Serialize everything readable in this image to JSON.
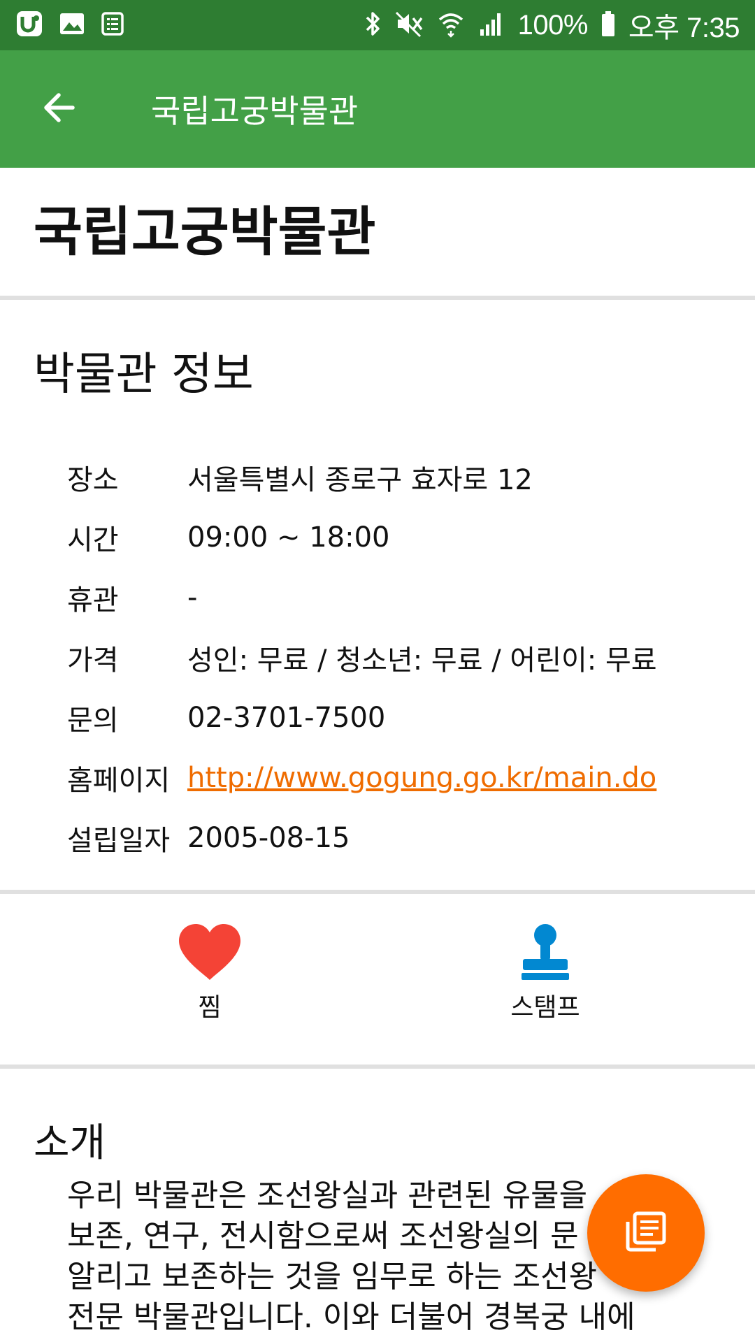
{
  "status_bar": {
    "battery": "100%",
    "time": "오후 7:35",
    "left_icons": [
      "u-plus-icon",
      "image-icon",
      "list-icon"
    ],
    "right_icons": [
      "bluetooth-icon",
      "mute-icon",
      "wifi-icon",
      "signal-icon",
      "battery-icon"
    ]
  },
  "app_bar": {
    "back_icon": "arrow-left-icon",
    "title": "국립고궁박물관"
  },
  "museum": {
    "name": "국립고궁박물관"
  },
  "info_section": {
    "title": "박물관 정보",
    "rows": [
      {
        "label": "장소",
        "value": "서울특별시 종로구 효자로 12"
      },
      {
        "label": "시간",
        "value": "09:00 ~ 18:00"
      },
      {
        "label": "휴관",
        "value": "-"
      },
      {
        "label": "가격",
        "value": "성인: 무료 / 청소년: 무료 / 어린이: 무료"
      },
      {
        "label": "문의",
        "value": "02-3701-7500"
      },
      {
        "label": "홈페이지",
        "value": "http://www.gogung.go.kr/main.do"
      },
      {
        "label": "설립일자",
        "value": "2005-08-15"
      }
    ]
  },
  "actions": {
    "favorite": {
      "label": "찜",
      "icon": "heart-icon",
      "color": "#f44336"
    },
    "stamp": {
      "label": "스탬프",
      "icon": "stamp-icon",
      "color": "#0288d1"
    }
  },
  "intro_section": {
    "title": "소개",
    "body_lines": [
      "우리 박물관은 조선왕실과 관련된 유물을",
      "보존, 연구, 전시함으로써 조선왕실의 문",
      "알리고 보존하는 것을 임무로 하는 조선왕",
      "전문 박물관입니다. 이와 더불어 경복궁 내에"
    ]
  },
  "fab": {
    "icon": "document-list-icon",
    "color": "#ff6d00"
  },
  "colors": {
    "status_bar": "#2e7d32",
    "app_bar": "#43a047",
    "link": "#ef6c00",
    "divider": "#e0e0e0"
  }
}
